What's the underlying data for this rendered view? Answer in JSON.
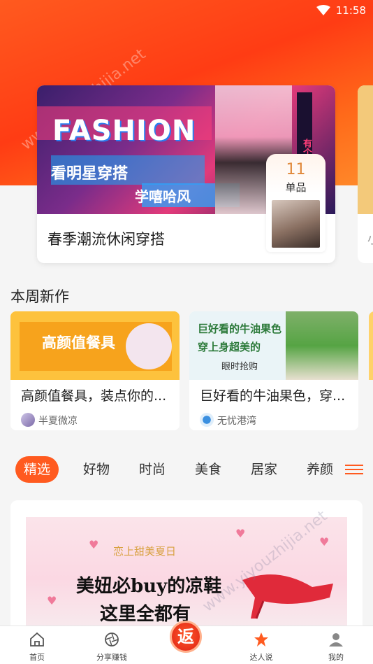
{
  "status_bar": {
    "time": "11:58"
  },
  "banner": {
    "fashion_title": "FASHION",
    "sub1": "看明星穿搭",
    "sub2": "学嘻哈风",
    "side_text": "有个性",
    "caption": "春季潮流休闲穿搭",
    "count": "11",
    "count_label": "单品"
  },
  "peek_card": {
    "text": "小"
  },
  "weekly_new": {
    "title": "本周新作",
    "cards": [
      {
        "image_text": "高颜值餐具",
        "title": "高颜值餐具，装点你的...",
        "author": "半夏微凉"
      },
      {
        "image_text_1": "巨好看的牛油果色",
        "image_text_2": "穿上身超美的",
        "image_text_3": "眼时抢购",
        "title": "巨好看的牛油果色，穿...",
        "author": "无忧港湾"
      }
    ]
  },
  "tabs": [
    {
      "label": "精选",
      "active": true
    },
    {
      "label": "好物"
    },
    {
      "label": "时尚"
    },
    {
      "label": "美食"
    },
    {
      "label": "居家"
    },
    {
      "label": "养颜"
    }
  ],
  "feed": {
    "tag": "恋上甜美夏日",
    "line1": "美妞必buy的凉鞋",
    "line2": "这里全都有"
  },
  "watermarks": [
    "www.yiyouzhijia.net",
    "www.yiyouzhijia.net"
  ],
  "bottom_nav": {
    "home": "首页",
    "share": "分享赚钱",
    "fan": "返",
    "daren": "达人说",
    "mine": "我的"
  },
  "colors": {
    "accent": "#ff5a1f"
  }
}
